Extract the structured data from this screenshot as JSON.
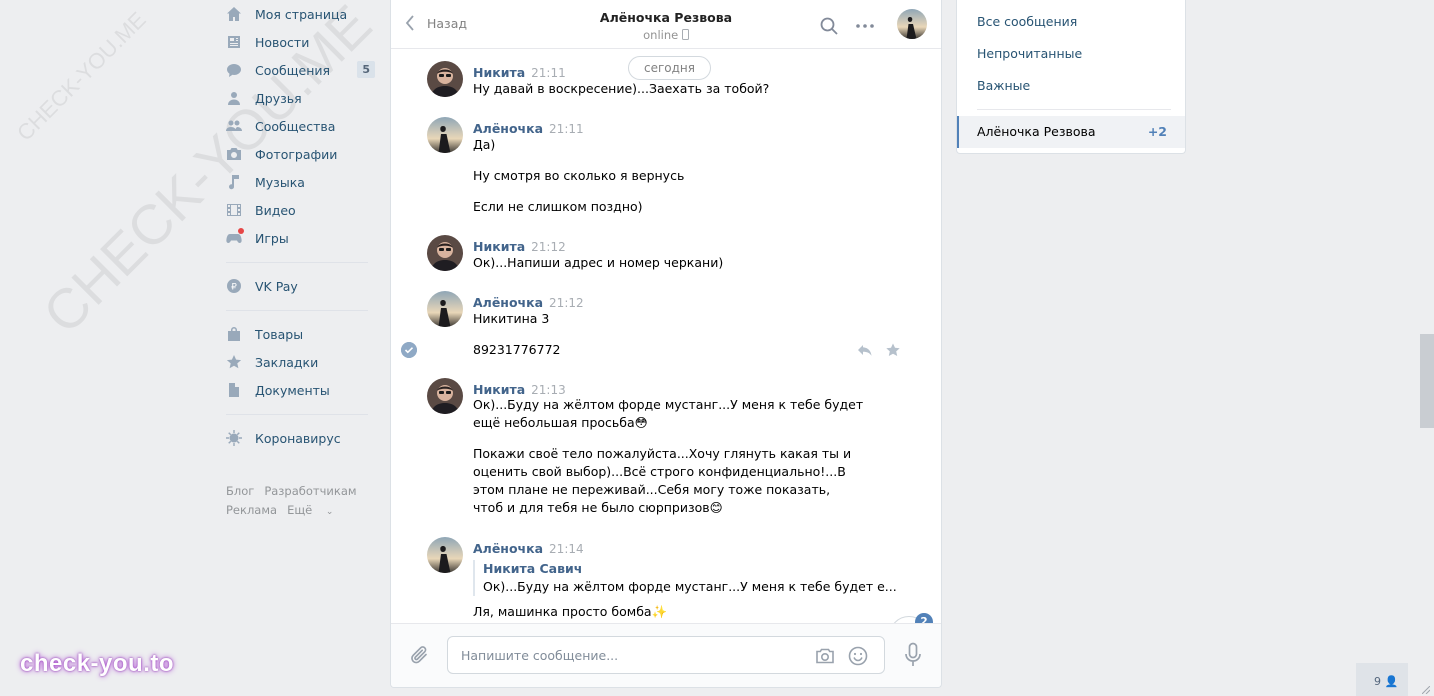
{
  "watermark": {
    "small": "CHECK-YOU.ME",
    "large": "CHECK-YOU.ME",
    "brand": "check-you.to"
  },
  "sidebar": {
    "items": [
      {
        "label": "Моя страница",
        "icon": "home-icon"
      },
      {
        "label": "Новости",
        "icon": "news-icon"
      },
      {
        "label": "Сообщения",
        "icon": "messages-icon",
        "count": "5"
      },
      {
        "label": "Друзья",
        "icon": "friends-icon"
      },
      {
        "label": "Сообщества",
        "icon": "communities-icon"
      },
      {
        "label": "Фотографии",
        "icon": "camera-icon"
      },
      {
        "label": "Музыка",
        "icon": "music-icon"
      },
      {
        "label": "Видео",
        "icon": "video-icon"
      },
      {
        "label": "Игры",
        "icon": "games-icon"
      }
    ],
    "pay": {
      "label": "VK Pay",
      "icon": "vkpay-icon"
    },
    "items2": [
      {
        "label": "Товары",
        "icon": "bag-icon"
      },
      {
        "label": "Закладки",
        "icon": "star-icon"
      },
      {
        "label": "Документы",
        "icon": "document-icon"
      }
    ],
    "corona": {
      "label": "Коронавирус",
      "icon": "virus-icon"
    },
    "footer": {
      "blog": "Блог",
      "dev": "Разработчикам",
      "ads": "Реклама",
      "more": "Ещё"
    }
  },
  "chat": {
    "back_label": "Назад",
    "peer_name": "Алёночка Резвова",
    "peer_status": "online",
    "date_pill": "сегодня",
    "messages": [
      {
        "name": "Никита",
        "time": "21:11",
        "lines": [
          "Ну давай в воскресение)...Заехать за тобой?"
        ]
      },
      {
        "name": "Алёночка",
        "time": "21:11",
        "lines": [
          "Да)",
          "Ну смотря во сколько я вернусь",
          "Если не слишком поздно)"
        ]
      },
      {
        "name": "Никита",
        "time": "21:12",
        "lines": [
          "Ок)...Напиши адрес и номер черкани)"
        ]
      },
      {
        "name": "Алёночка",
        "time": "21:12",
        "lines": [
          "Никитина 3",
          "89231776772"
        ]
      },
      {
        "name": "Никита",
        "time": "21:13",
        "lines": [
          "Ок)...Буду на жёлтом форде мустанг...У меня к тебе будет ещё небольшая просьба😳",
          "Покажи своё тело пожалуйста...Хочу глянуть какая ты и оценить свой выбор)...Всё строго конфиденциально!...В этом плане не переживай...Себя могу тоже показать, чтоб и для тебя не было сюрпризов😊"
        ]
      },
      {
        "name": "Алёночка",
        "time": "21:14",
        "reply_name": "Никита Савич",
        "reply_text": "Ок)...Буду на жёлтом форде мустанг...У меня к тебе будет е...",
        "lines": [
          "Ля, машинка просто бомба✨"
        ]
      }
    ],
    "unread_badge": "2",
    "composer_placeholder": "Напишите сообщение..."
  },
  "right_panel": {
    "all": "Все сообщения",
    "unread": "Непрочитанные",
    "important": "Важные",
    "selected_name": "Алёночка Резвова",
    "selected_count": "+2"
  },
  "online_count": "9",
  "colors": {
    "link": "#285473",
    "accent": "#5181b8",
    "name": "#42648b",
    "background": "#edeef0"
  }
}
